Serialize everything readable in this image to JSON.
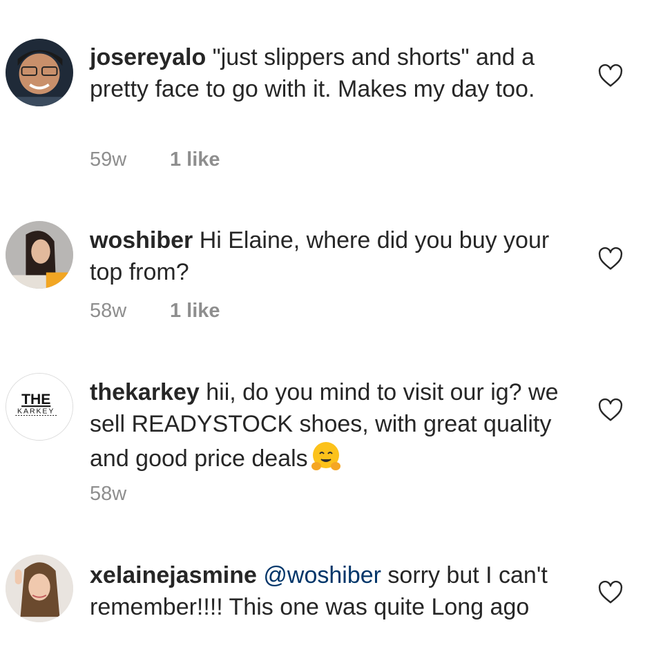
{
  "comments": [
    {
      "username": "josereyalo",
      "text": "\"just slippers and shorts\" and a pretty face to go with it. Makes my day too.",
      "time": "59w",
      "likes": "1 like"
    },
    {
      "username": "woshiber",
      "text": "Hi Elaine, where did you buy your top from?",
      "time": "58w",
      "likes": "1 like"
    },
    {
      "username": "thekarkey",
      "text": "hii, do you mind to visit our ig? we sell READYSTOCK shoes, with great quality and good price deals",
      "time": "58w",
      "avatar_logo_top": "THE",
      "avatar_logo_bottom": "KARKEY"
    },
    {
      "username": "xelainejasmine",
      "mention": "@woshiber",
      "text": "sorry but I can't remember!!!! This one was quite Long ago"
    }
  ],
  "icons": {
    "like": "heart-outline-icon",
    "emoji": "hugging-face-emoji"
  },
  "colors": {
    "text": "#262626",
    "meta": "#8e8e8e",
    "mention": "#003569",
    "heart": "#262626"
  }
}
